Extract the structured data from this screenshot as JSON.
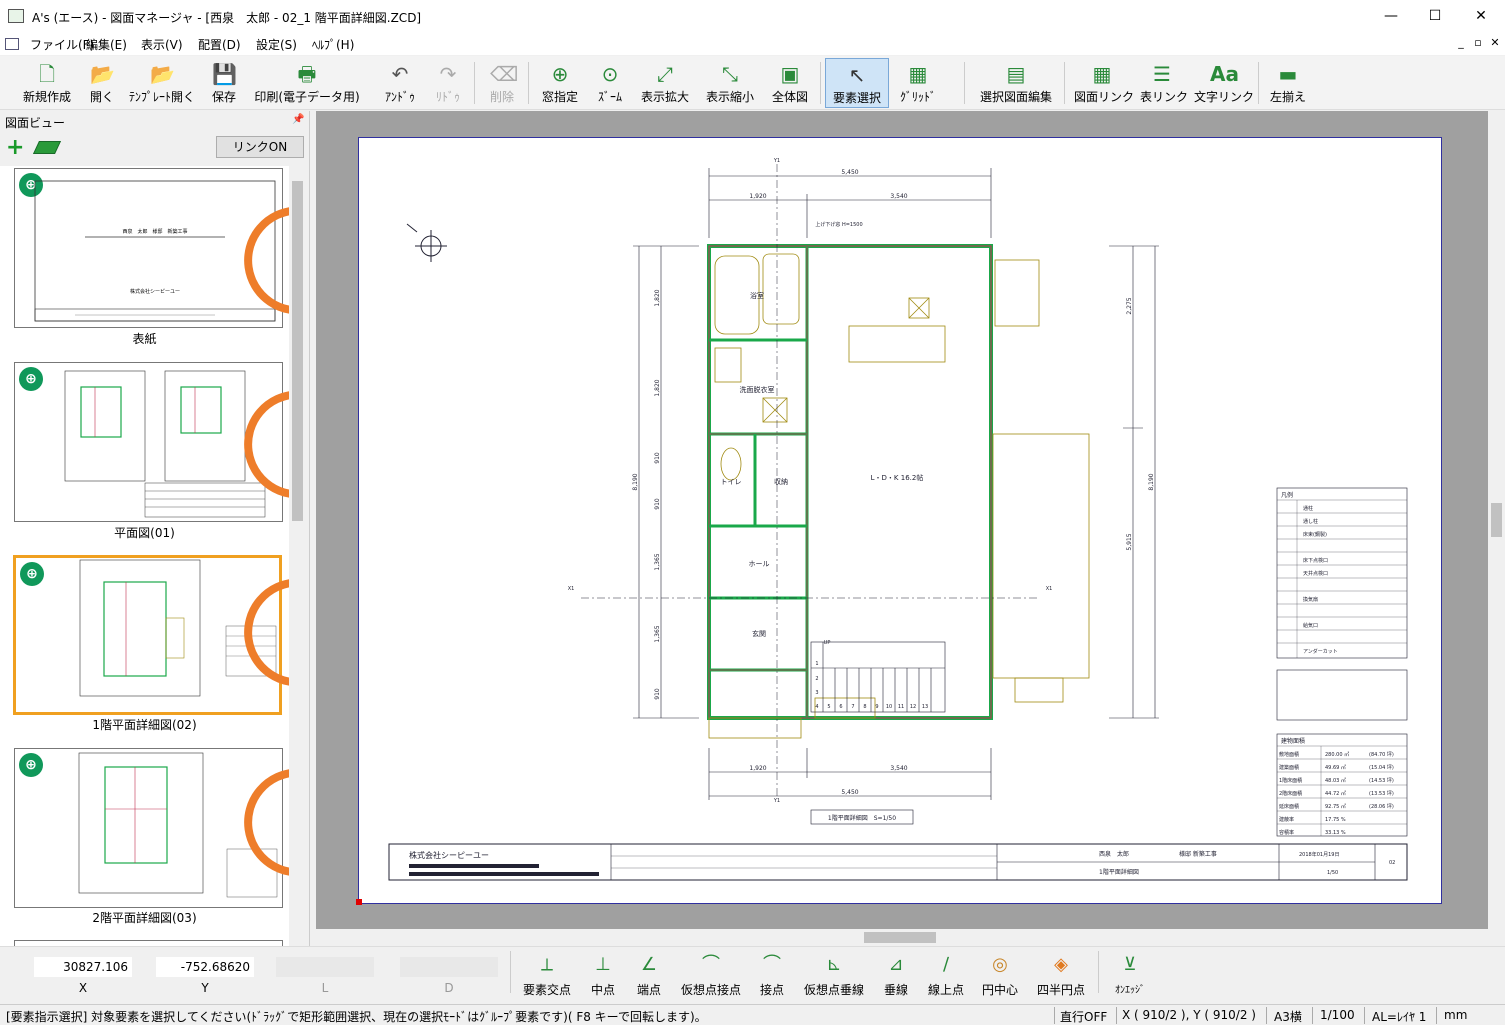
{
  "window": {
    "title": "A's (エース) - 図面マネージャ - [西泉　太郎 - 02_1 階平面詳細図.ZCD]",
    "min": "—",
    "max": "☐",
    "close": "✕"
  },
  "menu": [
    "ファイル(F)",
    "編集(E)",
    "表示(V)",
    "配置(D)",
    "設定(S)",
    "ﾍﾙﾌﾟ(H)"
  ],
  "mdi_buttons": [
    "_",
    "▫",
    "✕"
  ],
  "toolbar": [
    {
      "label": "新規作成",
      "icon": "new-doc-icon",
      "glyph": "🗋"
    },
    {
      "label": "開く",
      "icon": "open-folder-icon",
      "glyph": "📂"
    },
    {
      "label": "ﾃﾝﾌﾟﾚｰﾄ開く",
      "icon": "template-open-icon",
      "glyph": "📂"
    },
    {
      "label": "保存",
      "icon": "save-icon",
      "glyph": "💾"
    },
    {
      "label": "印刷(電子データ用)",
      "icon": "print-icon",
      "glyph": "🖶"
    },
    {
      "label": "ｱﾝﾄﾞｩ",
      "icon": "undo-icon",
      "glyph": "↶"
    },
    {
      "label": "ﾘﾄﾞｩ",
      "icon": "redo-icon",
      "glyph": "↷"
    },
    {
      "label": "削除",
      "icon": "delete-eraser-icon",
      "glyph": "⌫"
    },
    {
      "label": "窓指定",
      "icon": "window-zoom-icon",
      "glyph": "⊕"
    },
    {
      "label": "ｽﾞｰﾑ",
      "icon": "zoom-icon",
      "glyph": "⊙"
    },
    {
      "label": "表示拡大",
      "icon": "zoom-in-icon",
      "glyph": "⤢"
    },
    {
      "label": "表示縮小",
      "icon": "zoom-out-icon",
      "glyph": "⤡"
    },
    {
      "label": "全体図",
      "icon": "fit-all-icon",
      "glyph": "▣"
    },
    {
      "label": "要素選択",
      "icon": "select-arrow-icon",
      "glyph": "↖"
    },
    {
      "label": "ｸﾞﾘｯﾄﾞ",
      "icon": "grid-icon",
      "glyph": "▦"
    },
    {
      "label": "選択図面編集",
      "icon": "edit-drawing-icon",
      "glyph": "▤"
    },
    {
      "label": "図面リンク",
      "icon": "drawing-link-icon",
      "glyph": "▦"
    },
    {
      "label": "表リンク",
      "icon": "table-link-icon",
      "glyph": "☰"
    },
    {
      "label": "文字リンク",
      "icon": "text-link-icon",
      "glyph": "Aa"
    },
    {
      "label": "左揃え",
      "icon": "align-left-icon",
      "glyph": "▬"
    }
  ],
  "left_pane": {
    "header": "図面ビュー",
    "pin": "📌",
    "plus": "+",
    "link_button": "リンクON",
    "link_glyph": "⊕",
    "thumbnails": [
      {
        "caption": "表紙"
      },
      {
        "caption": "平面図(01)"
      },
      {
        "caption": "1階平面詳細図(02)"
      },
      {
        "caption": "2階平面詳細図(03)"
      }
    ]
  },
  "cover_thumb_texts": {
    "line1": "西泉　太郎　様邸　新築工事",
    "line2": "株式会社シーピーユー"
  },
  "drawing": {
    "dims_top": [
      "5,450",
      "1,920",
      "3,540"
    ],
    "dims_bottom": [
      "1,920",
      "3,540",
      "5,450"
    ],
    "dims_left": [
      "1,820",
      "1,820",
      "910",
      "910",
      "1,365",
      "1,365",
      "910"
    ],
    "dims_left_total": "8,190",
    "dims_right": [
      "2,275",
      "5,915"
    ],
    "dims_right_total": "8,190",
    "rooms": [
      {
        "name": "浴室"
      },
      {
        "name": "洗面脱衣室"
      },
      {
        "name": "トイレ"
      },
      {
        "name": "収納"
      },
      {
        "name": "ホール"
      },
      {
        "name": "玄関"
      },
      {
        "name": "L・D・K\n16.2帖"
      }
    ],
    "misc_text": [
      "上げ下げ窓 H=1500",
      "UP",
      "Y1",
      "Y1",
      "X1",
      "X1"
    ],
    "stair_numbers": [
      "1",
      "2",
      "3",
      "4",
      "5",
      "6",
      "7",
      "8",
      "9",
      "10",
      "11",
      "12",
      "13"
    ],
    "title_label": "1階平面詳細図　S=1/50",
    "title_block": {
      "company": "株式会社シーピーユー",
      "client": "西泉　太郎",
      "project": "様邸 新築工事",
      "date": "2018年01月19日",
      "drawing_name": "1階平面詳細図",
      "scale": "1/50",
      "number": "02"
    },
    "legend": {
      "title": "凡例",
      "items": [
        "通柱",
        "通し柱",
        "床束(鋼製)",
        "床下点検口",
        "天井点検口",
        "換気扇",
        "給気口",
        "アンダーカット"
      ]
    },
    "area_table": {
      "header": "建物面積",
      "rows": [
        [
          "敷地面積",
          "280.00 ㎡",
          "(84.70 坪)"
        ],
        [
          "建築面積",
          "49.69 ㎡",
          "(15.04 坪)"
        ],
        [
          "1階床面積",
          "48.03 ㎡",
          "(14.53 坪)"
        ],
        [
          "2階床面積",
          "44.72 ㎡",
          "(13.53 坪)"
        ],
        [
          "延床面積",
          "92.75 ㎡",
          "(28.06 坪)"
        ],
        [
          "建蔽率",
          "17.75 %",
          ""
        ],
        [
          "容積率",
          "33.13 %",
          ""
        ]
      ]
    },
    "colors": {
      "wall_green": "#1aa84a",
      "wall_red": "#c03050",
      "fixture": "#a08a10",
      "dim": "#223"
    }
  },
  "coords": {
    "x_value": "30827.106",
    "y_value": "-752.68620",
    "labels": [
      "X",
      "Y",
      "L",
      "D"
    ]
  },
  "snaps": [
    {
      "label": "要素交点",
      "icon": "intersection-snap-icon",
      "glyph": "⟂"
    },
    {
      "label": "中点",
      "icon": "midpoint-snap-icon",
      "glyph": "⊥"
    },
    {
      "label": "端点",
      "icon": "endpoint-snap-icon",
      "glyph": "∠"
    },
    {
      "label": "仮想点接点",
      "icon": "virtual-tangent-snap-icon",
      "glyph": "⌒"
    },
    {
      "label": "接点",
      "icon": "tangent-snap-icon",
      "glyph": "⌒"
    },
    {
      "label": "仮想点垂線",
      "icon": "virtual-perpendicular-snap-icon",
      "glyph": "⊾"
    },
    {
      "label": "垂線",
      "icon": "perpendicular-snap-icon",
      "glyph": "⊿"
    },
    {
      "label": "線上点",
      "icon": "on-line-snap-icon",
      "glyph": "∕"
    },
    {
      "label": "円中心",
      "icon": "circle-center-snap-icon",
      "glyph": "◎"
    },
    {
      "label": "四半円点",
      "icon": "quadrant-snap-icon",
      "glyph": "◈"
    },
    {
      "label": "ｵﾝｴｯｼﾞ",
      "icon": "on-edge-snap-icon",
      "glyph": "⊻"
    }
  ],
  "status": {
    "message": "[要素指示選択]  対象要素を選択してください(ﾄﾞﾗｯｸﾞで矩形範囲選択、現在の選択ﾓｰﾄﾞはｸﾞﾙｰﾌﾟ要素です)( F8  キーで回転します)。",
    "ortho": "直行OFF",
    "xy": "X ( 910/2 ), Y ( 910/2 )",
    "paper": "A3横",
    "scale": "1/100",
    "layer": "AL=ﾚｲﾔ 1",
    "unit": "mm"
  },
  "accent": {
    "orange": "#ee7d2a",
    "select_frame": "#f0a020",
    "link_green": "#10985a"
  }
}
